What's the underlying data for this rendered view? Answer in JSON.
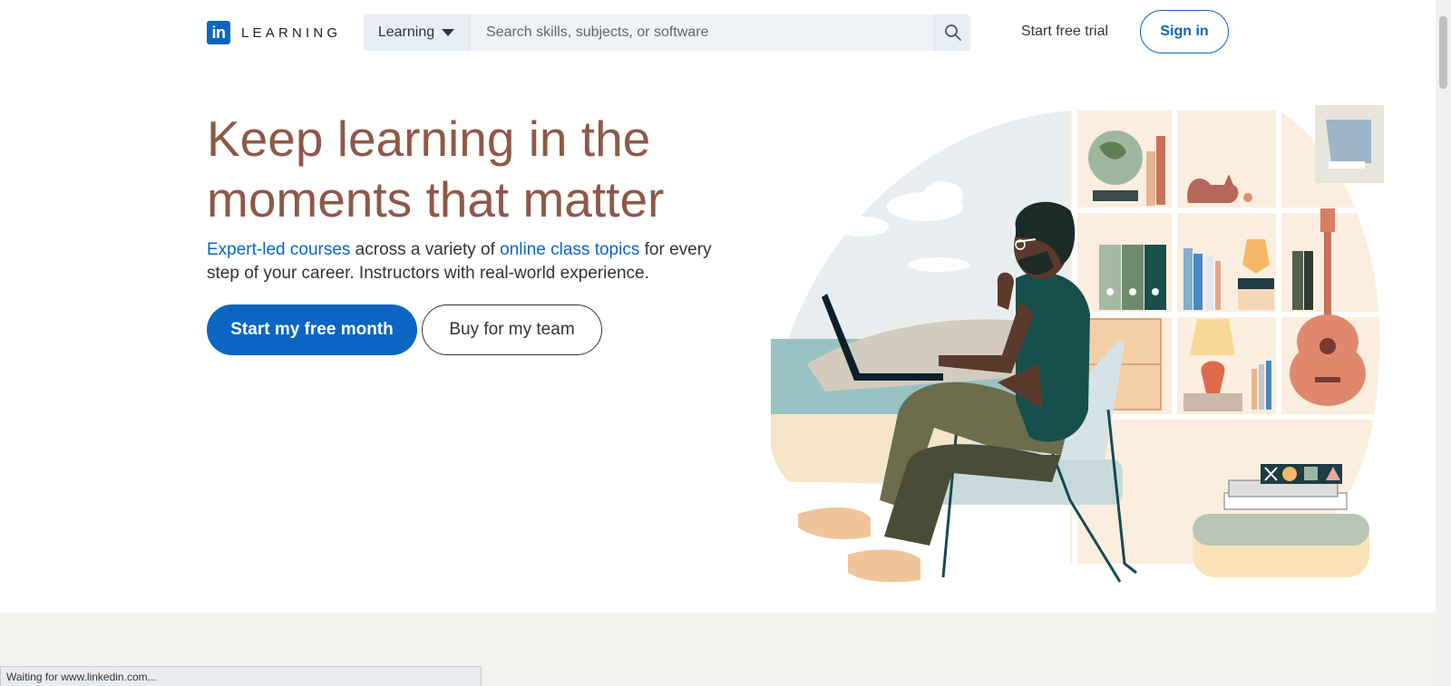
{
  "header": {
    "logo_letters": "in",
    "logo_text": "LEARNING",
    "search_category": "Learning",
    "search_placeholder": "Search skills, subjects, or software",
    "trial_label": "Start free trial",
    "signin_label": "Sign in"
  },
  "hero": {
    "title": "Keep learning in the moments that matter",
    "sub_link1": "Expert-led courses",
    "sub_text1": " across a variety of ",
    "sub_link2": "online class topics",
    "sub_text2": " for every step of your career. Instructors with real-world experience.",
    "primary_cta": "Start my free month",
    "secondary_cta": "Buy for my team"
  },
  "status_bar": {
    "text": "Waiting for www.linkedin.com..."
  },
  "colors": {
    "brand": "#0a66c2",
    "title": "#8f5849",
    "band": "#f3f2ef"
  }
}
